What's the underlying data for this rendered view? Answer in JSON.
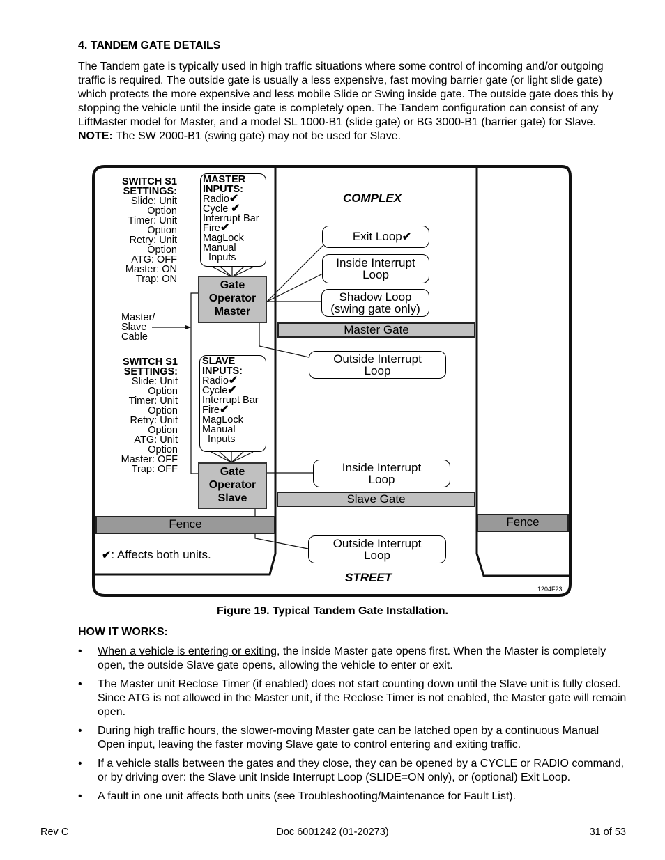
{
  "section_heading": "4.  TANDEM GATE DETAILS",
  "intro_text": "The Tandem gate is typically used in high traffic situations where some control of incoming and/or outgoing traffic is required.  The outside gate is usually a less expensive, fast moving barrier gate (or light slide gate) which protects the more expensive and less mobile Slide or Swing inside gate.  The outside gate does this by stopping the vehicle until the inside gate is completely open.  The Tandem configuration can consist of any LiftMaster model for Master, and a model SL 1000-B1 (slide gate) or BG 3000-B1 (barrier gate) for Slave.  ",
  "intro_note_label": "NOTE:",
  "intro_note_text": "  The SW 2000-B1 (swing gate) may not be used for Slave.",
  "diagram": {
    "check_glyph": "✔",
    "complex_label": "COMPLEX",
    "street_label": "STREET",
    "figure_code": "1204F23",
    "legend_text": ": Affects both units.",
    "master_switch": {
      "title": [
        "SWITCH S1",
        "SETTINGS:"
      ],
      "lines": [
        "Slide: Unit",
        "Option",
        "Timer: Unit",
        "Option",
        "Retry: Unit",
        "Option",
        "ATG: OFF",
        "Master: ON",
        "Trap: ON"
      ]
    },
    "slave_switch": {
      "title": [
        "SWITCH S1",
        "SETTINGS:"
      ],
      "lines": [
        "Slide: Unit",
        "Option",
        "Timer: Unit",
        "Option",
        "Retry: Unit",
        "Option",
        "ATG: Unit",
        "Option",
        "Master: OFF",
        "Trap: OFF"
      ]
    },
    "master_inputs": {
      "title": [
        "MASTER",
        "INPUTS:"
      ],
      "items": [
        {
          "label": "Radio",
          "check": true
        },
        {
          "label": "Cycle ",
          "check": true
        },
        {
          "label": "Interrupt Bar",
          "check": false
        },
        {
          "label": "Fire",
          "check": true
        },
        {
          "label": "MagLock",
          "check": false
        },
        {
          "label": "Manual",
          "check": false
        },
        {
          "label": "  Inputs",
          "check": false
        }
      ]
    },
    "slave_inputs": {
      "title": [
        "SLAVE",
        "INPUTS:"
      ],
      "items": [
        {
          "label": "Radio",
          "check": true
        },
        {
          "label": "Cycle",
          "check": true
        },
        {
          "label": "Interrupt Bar",
          "check": false
        },
        {
          "label": "Fire",
          "check": true
        },
        {
          "label": "MagLock",
          "check": false
        },
        {
          "label": "Manual",
          "check": false
        },
        {
          "label": "  Inputs",
          "check": false
        }
      ]
    },
    "master_operator": [
      "Gate",
      "Operator",
      "Master"
    ],
    "slave_operator": [
      "Gate",
      "Operator",
      "Slave"
    ],
    "cable_label": [
      "Master/",
      "Slave",
      "Cable"
    ],
    "loops": {
      "exit": "Exit Loop",
      "master_inside": [
        "Inside Interrupt",
        "Loop"
      ],
      "shadow": [
        "Shadow Loop",
        "(swing gate only)"
      ],
      "master_outside": [
        "Outside Interrupt",
        "Loop"
      ],
      "slave_inside": [
        "Inside Interrupt",
        "Loop"
      ],
      "slave_outside": [
        "Outside Interrupt",
        "Loop"
      ]
    },
    "master_gate": "Master Gate",
    "slave_gate": "Slave Gate",
    "fence_left": "Fence",
    "fence_right": "Fence"
  },
  "figure_caption": "Figure 19.  Typical Tandem Gate Installation.",
  "how_heading": "HOW IT WORKS:",
  "bullets": [
    {
      "underlined": "When a vehicle is entering or exiting",
      "text": ", the inside Master gate opens first.  When the Master is completely open, the outside Slave gate opens, allowing the vehicle to enter or exit."
    },
    {
      "underlined": "",
      "text": "The Master unit Reclose Timer (if enabled) does not start counting down until the Slave unit is fully closed.  Since ATG is not allowed in the Master unit, if the Reclose Timer is not enabled, the Master gate will remain open."
    },
    {
      "underlined": "",
      "text": "During high traffic hours, the slower-moving Master gate can be latched open by a continuous Manual Open input, leaving the faster moving Slave gate to control entering and exiting traffic."
    },
    {
      "underlined": "",
      "text": "If a vehicle stalls between the gates and they close, they can be opened by a CYCLE or RADIO command, or by driving over: the Slave unit Inside Interrupt Loop (SLIDE=ON only), or (optional) Exit Loop."
    },
    {
      "underlined": "",
      "text": "A fault in one unit affects both units (see Troubleshooting/Maintenance for Fault List)."
    }
  ],
  "bullet_glyph": "•",
  "footer": {
    "left": "Rev C",
    "center": "Doc 6001242 (01-20273)",
    "right": "31 of 53"
  }
}
